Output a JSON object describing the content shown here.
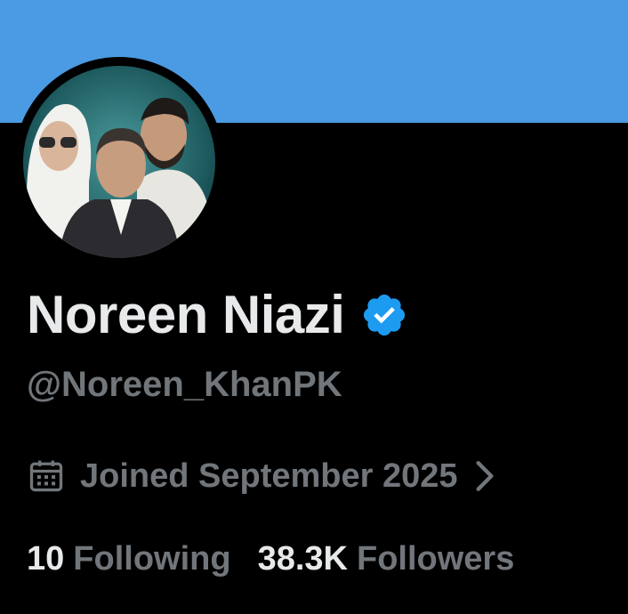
{
  "colors": {
    "banner": "#4a9be3",
    "background": "#000000",
    "primary_text": "#e7e9ea",
    "secondary_text": "#71767b",
    "verified_badge": "#1d9bf0"
  },
  "profile": {
    "display_name": "Noreen Niazi",
    "verified_icon": "verified-badge-icon",
    "handle": "@Noreen_KhanPK",
    "joined_icon": "calendar-icon",
    "joined_text": "Joined September 2025",
    "joined_chevron_icon": "chevron-right-icon"
  },
  "stats": {
    "following_count": "10",
    "following_label": "Following",
    "followers_count": "38.3K",
    "followers_label": "Followers"
  }
}
